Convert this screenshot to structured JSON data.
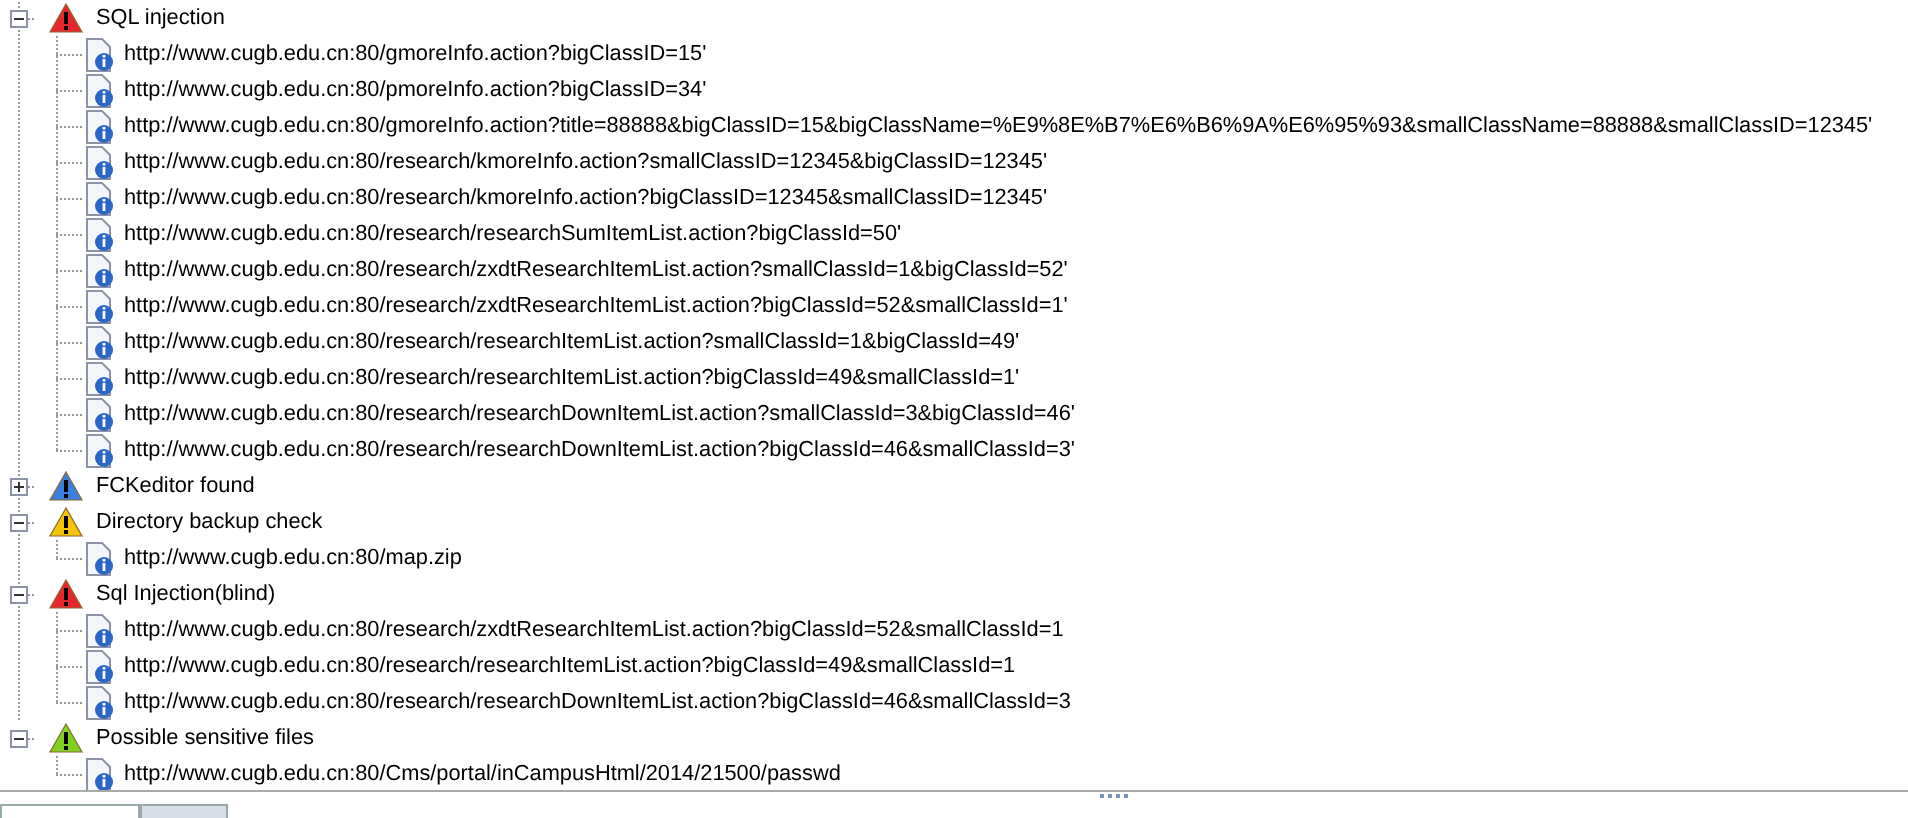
{
  "groups": [
    {
      "title": "SQL injection",
      "color": "#e8262b",
      "expanded": true,
      "items": [
        "http://www.cugb.edu.cn:80/gmoreInfo.action?bigClassID=15'",
        "http://www.cugb.edu.cn:80/pmoreInfo.action?bigClassID=34'",
        "http://www.cugb.edu.cn:80/gmoreInfo.action?title=88888&bigClassID=15&bigClassName=%E9%8E%B7%E6%B6%9A%E6%95%93&smallClassName=88888&smallClassID=12345'",
        "http://www.cugb.edu.cn:80/research/kmoreInfo.action?smallClassID=12345&bigClassID=12345'",
        "http://www.cugb.edu.cn:80/research/kmoreInfo.action?bigClassID=12345&smallClassID=12345'",
        "http://www.cugb.edu.cn:80/research/researchSumItemList.action?bigClassId=50'",
        "http://www.cugb.edu.cn:80/research/zxdtResearchItemList.action?smallClassId=1&bigClassId=52'",
        "http://www.cugb.edu.cn:80/research/zxdtResearchItemList.action?bigClassId=52&smallClassId=1'",
        "http://www.cugb.edu.cn:80/research/researchItemList.action?smallClassId=1&bigClassId=49'",
        "http://www.cugb.edu.cn:80/research/researchItemList.action?bigClassId=49&smallClassId=1'",
        "http://www.cugb.edu.cn:80/research/researchDownItemList.action?smallClassId=3&bigClassId=46'",
        "http://www.cugb.edu.cn:80/research/researchDownItemList.action?bigClassId=46&smallClassId=3'"
      ]
    },
    {
      "title": "FCKeditor found",
      "color": "#3a7fe0",
      "expanded": false
    },
    {
      "title": "Directory backup check",
      "color": "#f5c400",
      "expanded": true,
      "items": [
        "http://www.cugb.edu.cn:80/map.zip"
      ]
    },
    {
      "title": "Sql Injection(blind)",
      "color": "#e8262b",
      "expanded": true,
      "items": [
        "http://www.cugb.edu.cn:80/research/zxdtResearchItemList.action?bigClassId=52&smallClassId=1",
        "http://www.cugb.edu.cn:80/research/researchItemList.action?bigClassId=49&smallClassId=1",
        "http://www.cugb.edu.cn:80/research/researchDownItemList.action?bigClassId=46&smallClassId=3"
      ]
    },
    {
      "title": "Possible sensitive files",
      "color": "#7ed321",
      "expanded": true,
      "items": [
        "http://www.cugb.edu.cn:80/Cms/portal/inCampusHtml/2014/21500/passwd"
      ]
    }
  ],
  "bottom_tabs": [
    {
      "selected": true
    },
    {
      "selected": false
    }
  ]
}
